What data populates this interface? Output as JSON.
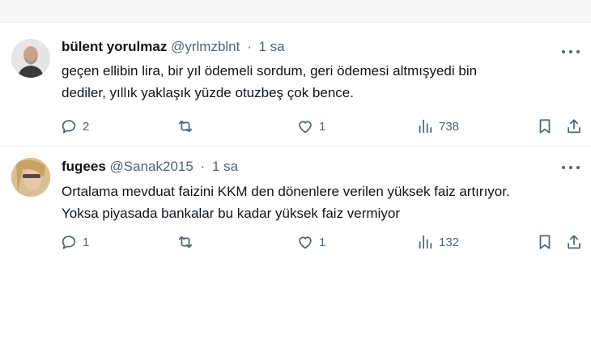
{
  "tweets": [
    {
      "name": "bülent yorulmaz",
      "handle": "@yrlmzblnt",
      "separator": "·",
      "time": "1 sa",
      "text_lines": [
        "geçen ellibin lira, bir yıl ödemeli sordum, geri ödemesi altmışyedi bin",
        "dediler, yıllık yaklaşık yüzde otuzbeş çok bence."
      ],
      "replies": "2",
      "retweets": "",
      "likes": "1",
      "views": "738"
    },
    {
      "name": "fugees",
      "handle": "@Sanak2015",
      "separator": "·",
      "time": "1 sa",
      "text_lines": [
        "Ortalama mevduat faizini KKM den dönenlere verilen yüksek faiz artırıyor.",
        "Yoksa piyasada bankalar bu kadar yüksek faiz vermiyor"
      ],
      "replies": "1",
      "retweets": "",
      "likes": "1",
      "views": "132"
    }
  ],
  "icons": {
    "reply": "reply-icon",
    "retweet": "retweet-icon",
    "like": "heart-icon",
    "views": "views-icon",
    "bookmark": "bookmark-icon",
    "share": "share-icon",
    "more": "more-icon"
  },
  "colors": {
    "text": "#0f1419",
    "secondary": "#536471",
    "divider": "#eff3f4"
  }
}
